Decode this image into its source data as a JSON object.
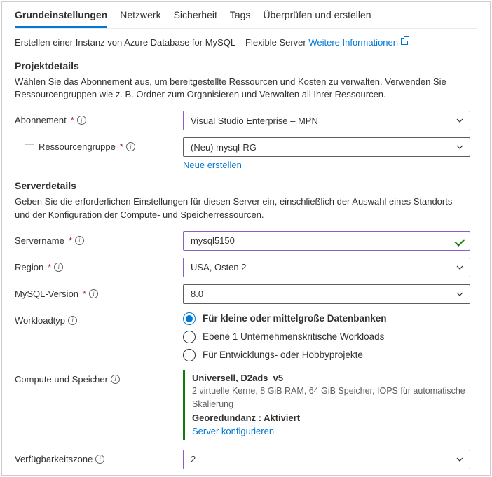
{
  "tabs": {
    "t0": "Grundeinstellungen",
    "t1": "Netzwerk",
    "t2": "Sicherheit",
    "t3": "Tags",
    "t4": "Überprüfen und erstellen"
  },
  "intro": {
    "text": "Erstellen einer Instanz von Azure Database for MySQL – Flexible Server ",
    "link": "Weitere Informationen"
  },
  "project": {
    "heading": "Projektdetails",
    "desc": "Wählen Sie das Abonnement aus, um bereitgestellte Ressourcen und Kosten zu verwalten. Verwenden Sie Ressourcengruppen wie z. B. Ordner zum Organisieren und Verwalten all Ihrer Ressourcen.",
    "subscription_label": "Abonnement",
    "subscription_value": "Visual Studio Enterprise – MPN",
    "rg_label": "Ressourcengruppe",
    "rg_value": "(Neu) mysql-RG",
    "rg_new": "Neue erstellen"
  },
  "server": {
    "heading": "Serverdetails",
    "desc": "Geben Sie die erforderlichen Einstellungen für diesen Server ein, einschließlich der Auswahl eines Standorts und der Konfiguration der Compute- und Speicherressourcen.",
    "name_label": "Servername",
    "name_value": "mysql5150",
    "region_label": "Region",
    "region_value": "USA, Osten 2",
    "version_label": "MySQL-Version",
    "version_value": "8.0",
    "workload_label": "Workloadtyp",
    "workload_opts": {
      "o0": "Für kleine oder mittelgroße Datenbanken",
      "o1": "Ebene 1 Unternehmenskritische Workloads",
      "o2": "Für Entwicklungs- oder Hobbyprojekte"
    },
    "compute_label": "Compute und Speicher",
    "compute": {
      "title": "Universell, D2ads_v5",
      "sub": "2 virtuelle Kerne, 8 GiB RAM, 64 GiB Speicher, IOPS für automatische Skalierung",
      "geo": "Georedundanz : Aktiviert",
      "config": "Server konfigurieren"
    },
    "az_label": "Verfügbarkeitszone",
    "az_value": "2"
  }
}
